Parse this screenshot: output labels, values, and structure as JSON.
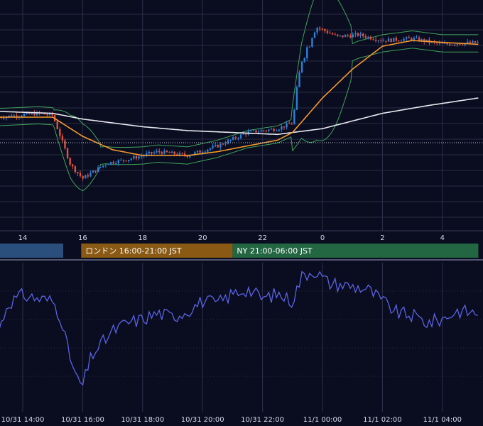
{
  "chart_data": [
    {
      "type": "candlestick",
      "title": "",
      "xlabel": "",
      "ylabel": "",
      "x_axis_ticks": [
        "14",
        "16",
        "18",
        "20",
        "22",
        "0",
        "2",
        "4"
      ],
      "x_hours_range": [
        13.2,
        5.2
      ],
      "grid": true,
      "session_bands": [
        {
          "label": "",
          "start": 13.2,
          "end": 15.35,
          "color": "#2b4f7c"
        },
        {
          "label": "ロンドン 16:00-21:00 JST",
          "start": 15.95,
          "end": 21.0,
          "color": "#8a5a14"
        },
        {
          "label": "NY 21:00-06:00 JST",
          "start": 21.0,
          "end": 29.2,
          "color": "#236642"
        }
      ],
      "colors": {
        "up": "#2f7fd6",
        "down": "#e0533c",
        "bands": "#3fa45a",
        "ma_fast": "#f59a2c",
        "ma_slow": "#e8e8f0",
        "oscillator": "#5b63e6",
        "grid": "#2e3148",
        "background": "#0a0c1f"
      },
      "series": [
        {
          "name": "",
          "kind": "price",
          "key_points": [
            [
              13.2,
              0.5
            ],
            [
              14.5,
              0.52
            ],
            [
              15.0,
              0.51
            ],
            [
              15.6,
              0.25
            ],
            [
              16.0,
              0.18
            ],
            [
              16.8,
              0.26
            ],
            [
              17.5,
              0.28
            ],
            [
              18.5,
              0.32
            ],
            [
              19.5,
              0.3
            ],
            [
              20.5,
              0.35
            ],
            [
              21.5,
              0.42
            ],
            [
              22.5,
              0.44
            ],
            [
              23.0,
              0.47
            ],
            [
              23.3,
              0.8
            ],
            [
              23.8,
              0.97
            ],
            [
              24.5,
              0.92
            ],
            [
              25.2,
              0.93
            ],
            [
              26.0,
              0.9
            ],
            [
              27.0,
              0.91
            ],
            [
              28.0,
              0.88
            ],
            [
              29.2,
              0.89
            ]
          ]
        },
        {
          "name": "",
          "kind": "ma_fast",
          "key_points": [
            [
              13.2,
              0.5
            ],
            [
              15.0,
              0.5
            ],
            [
              16.0,
              0.4
            ],
            [
              17.0,
              0.33
            ],
            [
              18.0,
              0.3
            ],
            [
              19.5,
              0.3
            ],
            [
              20.5,
              0.32
            ],
            [
              21.5,
              0.35
            ],
            [
              22.5,
              0.38
            ],
            [
              23.0,
              0.42
            ],
            [
              24.0,
              0.6
            ],
            [
              25.0,
              0.75
            ],
            [
              26.0,
              0.87
            ],
            [
              27.0,
              0.9
            ],
            [
              28.0,
              0.89
            ],
            [
              29.2,
              0.88
            ]
          ]
        },
        {
          "name": "",
          "kind": "ma_slow",
          "key_points": [
            [
              13.2,
              0.53
            ],
            [
              15.0,
              0.52
            ],
            [
              16.0,
              0.49
            ],
            [
              17.0,
              0.47
            ],
            [
              18.0,
              0.45
            ],
            [
              19.5,
              0.43
            ],
            [
              21.0,
              0.42
            ],
            [
              22.5,
              0.41
            ],
            [
              24.0,
              0.44
            ],
            [
              25.0,
              0.48
            ],
            [
              26.0,
              0.52
            ],
            [
              27.5,
              0.56
            ],
            [
              29.2,
              0.6
            ]
          ]
        },
        {
          "name": "",
          "kind": "oscillator",
          "key_points": [
            [
              13.2,
              0.55
            ],
            [
              13.5,
              0.78
            ],
            [
              14.0,
              0.85
            ],
            [
              14.5,
              0.82
            ],
            [
              15.0,
              0.8
            ],
            [
              15.3,
              0.65
            ],
            [
              15.5,
              0.4
            ],
            [
              15.8,
              0.15
            ],
            [
              16.0,
              0.1
            ],
            [
              16.3,
              0.35
            ],
            [
              17.0,
              0.55
            ],
            [
              17.5,
              0.62
            ],
            [
              18.0,
              0.65
            ],
            [
              18.5,
              0.7
            ],
            [
              19.0,
              0.67
            ],
            [
              19.5,
              0.72
            ],
            [
              20.0,
              0.8
            ],
            [
              20.5,
              0.78
            ],
            [
              21.0,
              0.86
            ],
            [
              21.5,
              0.9
            ],
            [
              22.0,
              0.82
            ],
            [
              22.5,
              0.86
            ],
            [
              23.0,
              0.8
            ],
            [
              23.3,
              1.0
            ],
            [
              23.7,
              1.06
            ],
            [
              24.2,
              0.95
            ],
            [
              24.8,
              0.93
            ],
            [
              25.5,
              0.9
            ],
            [
              26.0,
              0.8
            ],
            [
              26.5,
              0.7
            ],
            [
              27.0,
              0.68
            ],
            [
              27.5,
              0.62
            ],
            [
              28.0,
              0.65
            ],
            [
              28.5,
              0.72
            ],
            [
              29.2,
              0.7
            ]
          ]
        }
      ]
    }
  ],
  "x_axis_bottom": [
    "10/31 14:00",
    "10/31 16:00",
    "10/31 18:00",
    "10/31 20:00",
    "10/31 22:00",
    "11/1 00:00",
    "11/1 02:00",
    "11/1 04:00"
  ]
}
